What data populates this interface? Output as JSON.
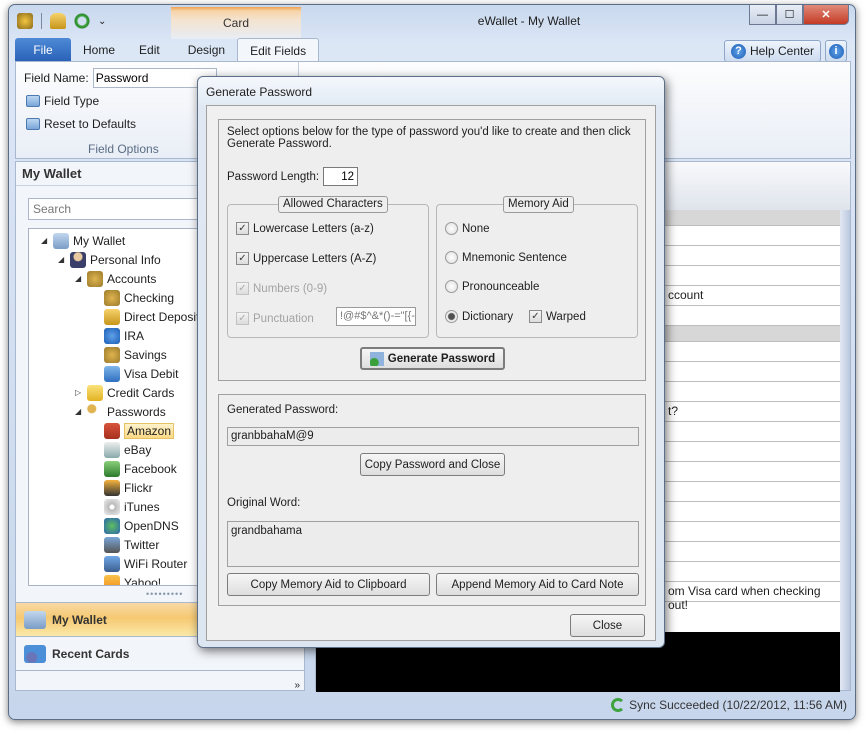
{
  "window": {
    "title": "eWallet - My Wallet",
    "context_tab": "Card",
    "controls": {
      "minimize": "—",
      "maximize": "☐",
      "close": "✕"
    }
  },
  "quick_access": {
    "icons": [
      "app-icon",
      "lock-icon",
      "sync-icon",
      "customize-qat-icon"
    ],
    "customize_glyph": "⌄"
  },
  "ribbon": {
    "tabs": [
      {
        "label": "File"
      },
      {
        "label": "Home"
      },
      {
        "label": "Edit"
      },
      {
        "label": "Design"
      },
      {
        "label": "Edit Fields",
        "active": true
      }
    ],
    "help_label": "Help Center",
    "field_name_label": "Field Name:",
    "field_name_value": "Password",
    "field_type_label": "Field Type",
    "reset_label": "Reset to Defaults",
    "group_label": "Field Options"
  },
  "sidebar": {
    "title": "My Wallet",
    "search_placeholder": "Search",
    "tree": [
      {
        "label": "My Wallet",
        "level": 0,
        "toggle": "◢",
        "icon": "wallet-icon"
      },
      {
        "label": "Personal Info",
        "level": 1,
        "toggle": "◢",
        "icon": "person-icon"
      },
      {
        "label": "Accounts",
        "level": 2,
        "toggle": "◢",
        "icon": "money-bag-icon"
      },
      {
        "label": "Checking",
        "level": 3,
        "icon": "money-bag-icon"
      },
      {
        "label": "Direct Deposit",
        "level": 3,
        "icon": "card-icon"
      },
      {
        "label": "IRA",
        "level": 3,
        "icon": "info-icon"
      },
      {
        "label": "Savings",
        "level": 3,
        "icon": "money-bag-icon"
      },
      {
        "label": "Visa Debit",
        "level": 3,
        "icon": "credit-card-icon"
      },
      {
        "label": "Credit Cards",
        "level": 2,
        "toggle": "▷",
        "icon": "folder-icon"
      },
      {
        "label": "Passwords",
        "level": 2,
        "toggle": "◢",
        "icon": "key-icon"
      },
      {
        "label": "Amazon",
        "level": 3,
        "icon": "house-icon",
        "selected": true
      },
      {
        "label": "eBay",
        "level": 3,
        "icon": "ebay-icon"
      },
      {
        "label": "Facebook",
        "level": 3,
        "icon": "facebook-icon"
      },
      {
        "label": "Flickr",
        "level": 3,
        "icon": "flickr-icon"
      },
      {
        "label": "iTunes",
        "level": 3,
        "icon": "cd-icon"
      },
      {
        "label": "OpenDNS",
        "level": 3,
        "icon": "globe-icon"
      },
      {
        "label": "Twitter",
        "level": 3,
        "icon": "phone-icon"
      },
      {
        "label": "WiFi Router",
        "level": 3,
        "icon": "computer-icon"
      },
      {
        "label": "Yahoo!",
        "level": 3,
        "icon": "yahoo-icon"
      }
    ],
    "nav": [
      {
        "label": "My Wallet",
        "active": true
      },
      {
        "label": "Recent Cards"
      }
    ],
    "overflow_glyph": "»"
  },
  "content": {
    "rows": [
      "",
      "",
      "",
      "",
      "ccount",
      "",
      "",
      "",
      "",
      "",
      "t?",
      "",
      "",
      "",
      "",
      "",
      "",
      "",
      "",
      "om Visa card when checking out!"
    ]
  },
  "status": {
    "text": "Sync Succeeded (10/22/2012, 11:56 AM)"
  },
  "dialog": {
    "title": "Generate Password",
    "intro": "Select options below for the type of password you'd like to create and then click Generate Password.",
    "length_label": "Password Length:",
    "length_value": "12",
    "allowed": {
      "title": "Allowed Characters",
      "options": [
        {
          "label": "Lowercase Letters (a-z)",
          "checked": true,
          "enabled": true
        },
        {
          "label": "Uppercase Letters (A-Z)",
          "checked": true,
          "enabled": true
        },
        {
          "label": "Numbers (0-9)",
          "checked": true,
          "enabled": false
        },
        {
          "label": "Punctuation",
          "checked": true,
          "enabled": false
        }
      ],
      "punctuation_value": "!@#$^&*()-=\"[{-|"
    },
    "memory": {
      "title": "Memory Aid",
      "options": [
        {
          "label": "None",
          "selected": false
        },
        {
          "label": "Mnemonic Sentence",
          "selected": false
        },
        {
          "label": "Pronounceable",
          "selected": false
        },
        {
          "label": "Dictionary",
          "selected": true
        }
      ],
      "warped_label": "Warped",
      "warped_checked": true
    },
    "generate_label": "Generate Password",
    "generated_label": "Generated Password:",
    "generated_value": "granbbahaM@9",
    "copy_close_label": "Copy Password and Close",
    "original_label": "Original Word:",
    "original_value": "grandbahama",
    "copy_aid_label": "Copy Memory Aid to Clipboard",
    "append_aid_label": "Append Memory Aid to Card Note",
    "close_label": "Close"
  }
}
